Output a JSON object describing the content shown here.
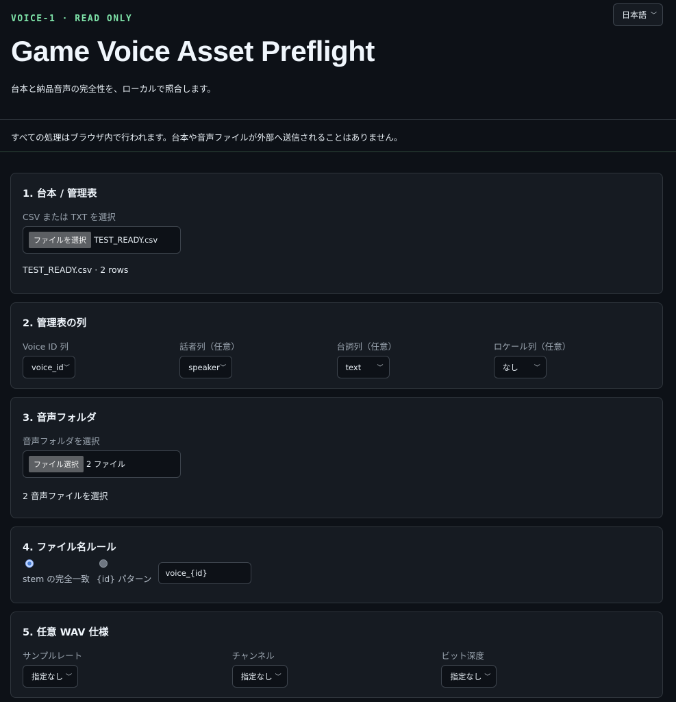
{
  "header": {
    "eyebrow": "VOICE-1 · READ ONLY",
    "title": "Game Voice Asset Preflight",
    "subtitle": "台本と納品音声の完全性を、ローカルで照合します。",
    "language": "日本語"
  },
  "notice": "すべての処理はブラウザ内で行われます。台本や音声ファイルが外部へ送信されることはありません。",
  "section1": {
    "title": "1. 台本 / 管理表",
    "label": "CSV または TXT を選択",
    "button": "ファイルを選択",
    "filename": "TEST_READY.csv",
    "status": "TEST_READY.csv · 2 rows"
  },
  "section2": {
    "title": "2. 管理表の列",
    "fields": [
      {
        "label": "Voice ID 列",
        "value": "voice_id"
      },
      {
        "label": "話者列（任意）",
        "value": "speaker"
      },
      {
        "label": "台詞列（任意）",
        "value": "text"
      },
      {
        "label": "ロケール列（任意）",
        "value": "なし"
      }
    ]
  },
  "section3": {
    "title": "3. 音声フォルダ",
    "label": "音声フォルダを選択",
    "button": "ファイル選択",
    "filename": "2 ファイル",
    "status": "2 音声ファイルを選択"
  },
  "section4": {
    "title": "4. ファイル名ルール",
    "option_exact": "stem の完全一致",
    "option_pattern": "{id} パターン",
    "pattern_value": "voice_{id}",
    "selected": "exact"
  },
  "section5": {
    "title": "5. 任意 WAV 仕様",
    "fields": [
      {
        "label": "サンプルレート",
        "value": "指定なし"
      },
      {
        "label": "チャンネル",
        "value": "指定なし"
      },
      {
        "label": "ビット深度",
        "value": "指定なし"
      }
    ]
  }
}
